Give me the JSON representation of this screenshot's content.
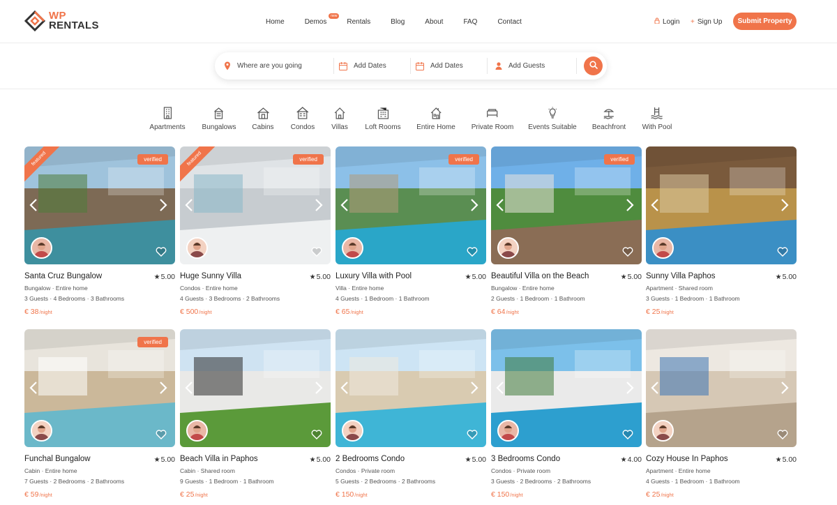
{
  "brand": {
    "logo_line1": "WP",
    "logo_line2": "RENTALS",
    "accent_color": "#f0744a"
  },
  "nav": [
    {
      "label": "Home"
    },
    {
      "label": "Demos",
      "badge": "new"
    },
    {
      "label": "Rentals"
    },
    {
      "label": "Blog"
    },
    {
      "label": "About"
    },
    {
      "label": "FAQ"
    },
    {
      "label": "Contact"
    }
  ],
  "auth": {
    "login_label": "Login",
    "login_icon": "lock-icon",
    "signup_label": "Sign Up",
    "signup_icon": "plus-icon",
    "submit_label": "Submit Property"
  },
  "search": {
    "location_placeholder": "Where are you going",
    "checkin_placeholder": "Add Dates",
    "checkout_placeholder": "Add Dates",
    "guests_placeholder": "Add Guests",
    "search_icon": "search-icon"
  },
  "categories": [
    {
      "label": "Apartments",
      "icon": "apartment-icon"
    },
    {
      "label": "Bungalows",
      "icon": "bungalow-icon"
    },
    {
      "label": "Cabins",
      "icon": "cabin-icon"
    },
    {
      "label": "Condos",
      "icon": "condo-icon"
    },
    {
      "label": "Villas",
      "icon": "villa-icon"
    },
    {
      "label": "Loft Rooms",
      "icon": "loft-icon"
    },
    {
      "label": "Entire Home",
      "icon": "entire-home-icon"
    },
    {
      "label": "Private Room",
      "icon": "private-room-icon"
    },
    {
      "label": "Events Suitable",
      "icon": "events-icon"
    },
    {
      "label": "Beachfront",
      "icon": "beachfront-icon"
    },
    {
      "label": "With Pool",
      "icon": "pool-icon"
    }
  ],
  "listings": [
    {
      "title": "Santa Cruz Bungalow",
      "rating": "5.00",
      "type": "Bungalow · Entire home",
      "meta": "3 Guests · 4 Bedrooms · 3 Bathrooms",
      "price": "€ 38",
      "per": "/night",
      "featured": "featured",
      "verified": "verified"
    },
    {
      "title": "Huge Sunny Villa",
      "rating": "5.00",
      "type": "Condos · Entire home",
      "meta": "4 Guests · 3 Bedrooms · 2 Bathrooms",
      "price": "€ 500",
      "per": "/night",
      "featured": "featured",
      "verified": "verified"
    },
    {
      "title": "Luxury Villa with Pool",
      "rating": "5.00",
      "type": "Villa · Entire home",
      "meta": "4 Guests · 1 Bedroom · 1 Bathroom",
      "price": "€ 65",
      "per": "/night",
      "featured": "",
      "verified": "verified"
    },
    {
      "title": "Beautiful Villa on the Beach",
      "rating": "5.00",
      "type": "Bungalow · Entire home",
      "meta": "2 Guests · 1 Bedroom · 1 Bathroom",
      "price": "€ 64",
      "per": "/night",
      "featured": "",
      "verified": "verified"
    },
    {
      "title": "Sunny Villa Paphos",
      "rating": "5.00",
      "type": "Apartment · Shared room",
      "meta": "3 Guests · 1 Bedroom · 1 Bathroom",
      "price": "€ 25",
      "per": "/night",
      "featured": "",
      "verified": ""
    },
    {
      "title": "Funchal Bungalow",
      "rating": "5.00",
      "type": "Cabin · Entire home",
      "meta": "7 Guests · 2 Bedrooms · 2 Bathrooms",
      "price": "€ 59",
      "per": "/night",
      "featured": "",
      "verified": "verified"
    },
    {
      "title": "Beach Villa in Paphos",
      "rating": "5.00",
      "type": "Cabin · Shared room",
      "meta": "9 Guests · 1 Bedroom · 1 Bathroom",
      "price": "€ 25",
      "per": "/night",
      "featured": "",
      "verified": ""
    },
    {
      "title": "2 Bedrooms Condo",
      "rating": "5.00",
      "type": "Condos · Private room",
      "meta": "5 Guests · 2 Bedrooms · 2 Bathrooms",
      "price": "€ 150",
      "per": "/night",
      "featured": "",
      "verified": ""
    },
    {
      "title": "3 Bedrooms Condo",
      "rating": "4.00",
      "type": "Condos · Private room",
      "meta": "3 Guests · 2 Bedrooms · 2 Bathrooms",
      "price": "€ 150",
      "per": "/night",
      "featured": "",
      "verified": ""
    },
    {
      "title": "Cozy House In Paphos",
      "rating": "5.00",
      "type": "Apartment · Entire home",
      "meta": "4 Guests · 1 Bedroom · 1 Bathroom",
      "price": "€ 25",
      "per": "/night",
      "featured": "",
      "verified": ""
    }
  ]
}
